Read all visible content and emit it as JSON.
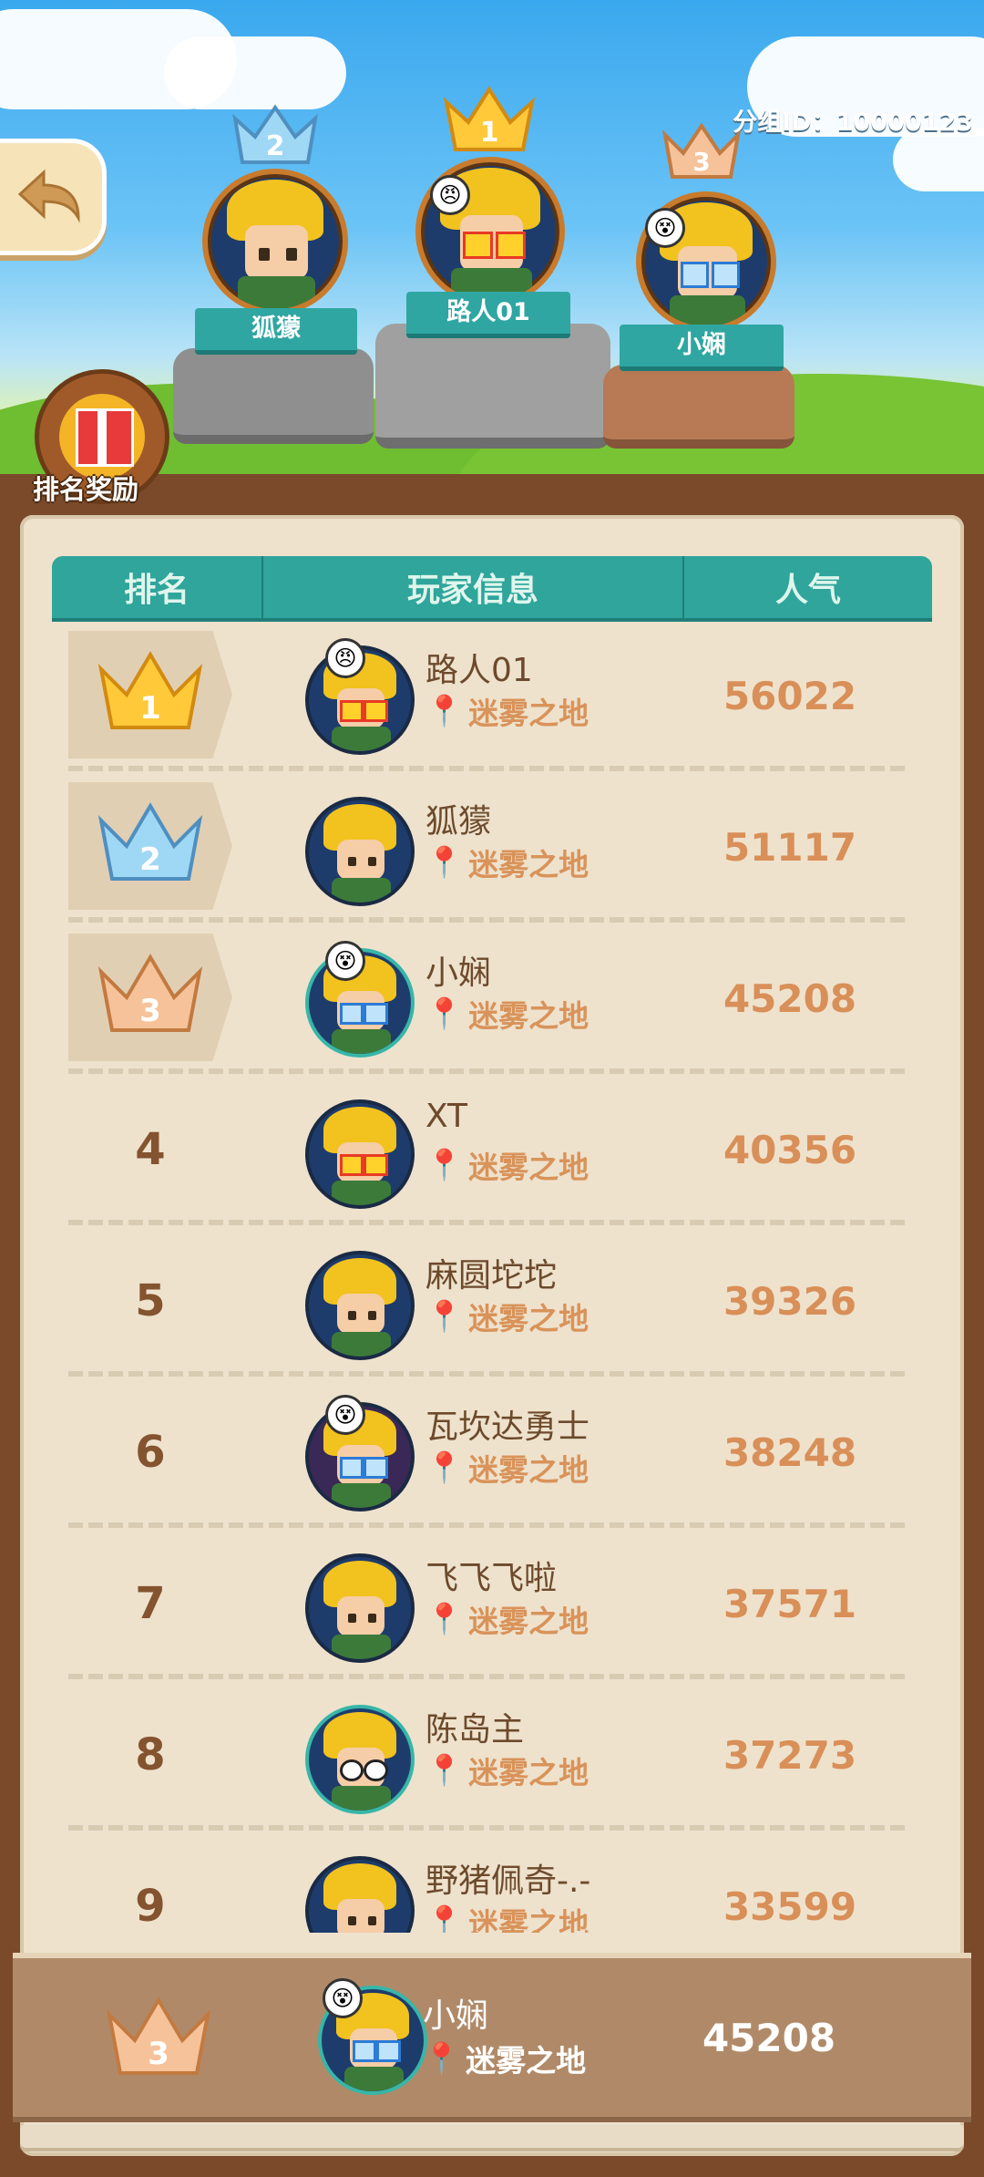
{
  "header_info": {
    "group_id": "分组ID：10000123"
  },
  "reward_button": {
    "label": "排名奖励"
  },
  "podium": [
    {
      "place": "2",
      "name": "狐獴"
    },
    {
      "place": "1",
      "name": "路人01"
    },
    {
      "place": "3",
      "name": "小娴"
    }
  ],
  "table": {
    "columns": [
      "排名",
      "玩家信息",
      "人气"
    ],
    "rows": [
      {
        "rank": "1",
        "name": "路人01",
        "location": "迷雾之地",
        "score": "56022"
      },
      {
        "rank": "2",
        "name": "狐獴",
        "location": "迷雾之地",
        "score": "51117"
      },
      {
        "rank": "3",
        "name": "小娴",
        "location": "迷雾之地",
        "score": "45208"
      },
      {
        "rank": "4",
        "name": "XT",
        "location": "迷雾之地",
        "score": "40356"
      },
      {
        "rank": "5",
        "name": "麻圆坨坨",
        "location": "迷雾之地",
        "score": "39326"
      },
      {
        "rank": "6",
        "name": "瓦坎达勇士",
        "location": "迷雾之地",
        "score": "38248"
      },
      {
        "rank": "7",
        "name": "飞飞飞啦",
        "location": "迷雾之地",
        "score": "37571"
      },
      {
        "rank": "8",
        "name": "陈岛主",
        "location": "迷雾之地",
        "score": "37273"
      },
      {
        "rank": "9",
        "name": "野猪佩奇-.-",
        "location": "迷雾之地",
        "score": "33599"
      }
    ]
  },
  "self": {
    "rank": "3",
    "name": "小娴",
    "location": "迷雾之地",
    "score": "45208"
  },
  "colors": {
    "gold": "#f3b425",
    "silver": "#7cc7ec",
    "bronze": "#e0a06a",
    "teal": "#2fa59c"
  }
}
